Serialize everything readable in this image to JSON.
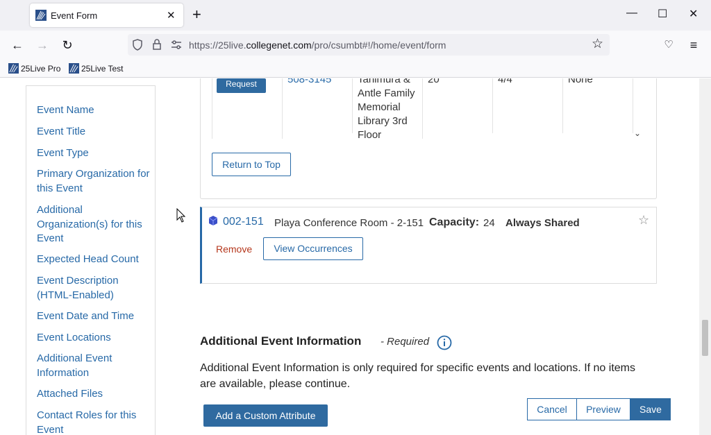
{
  "browser": {
    "tab_title": "Event Form",
    "url_prefix": "https://25live.",
    "url_domain": "collegenet.com",
    "url_path": "/pro/csumbt#!/home/event/form",
    "bookmarks": [
      "25Live Pro",
      "25Live Test"
    ]
  },
  "sidenav": {
    "items": [
      "Event Name",
      "Event Title",
      "Event Type",
      "Primary Organization for this Event",
      "Additional Organization(s) for this Event",
      "Expected Head Count",
      "Event Description (HTML-Enabled)",
      "Event Date and Time",
      "Event Locations",
      "Additional Event Information",
      "Attached Files",
      "Contact Roles for this Event"
    ]
  },
  "location_row": {
    "request_label": "Request",
    "code": "508-3145",
    "name_lines": [
      "Tanimura &",
      "Antle Family",
      "Memorial",
      "Library 3rd",
      "Floor"
    ],
    "capacity": "20",
    "ratio": "4/4",
    "shared": "None",
    "return_top_label": "Return to Top"
  },
  "location_card": {
    "code": "002-151",
    "name": "Playa Conference Room - 2-151",
    "capacity_label": "Capacity:",
    "capacity_value": "24",
    "shared": "Always Shared",
    "remove_label": "Remove",
    "view_occurrences_label": "View Occurrences"
  },
  "additional_info": {
    "title": "Additional Event Information",
    "required": "- Required",
    "description": "Additional Event Information is only required for specific events and locations. If no items are available, please continue.",
    "add_attribute_label": "Add a Custom Attribute"
  },
  "actions": {
    "cancel": "Cancel",
    "preview": "Preview",
    "save": "Save"
  },
  "colors": {
    "accent": "#2f6aa0",
    "link": "#2769a7",
    "remove": "#b5371c"
  }
}
